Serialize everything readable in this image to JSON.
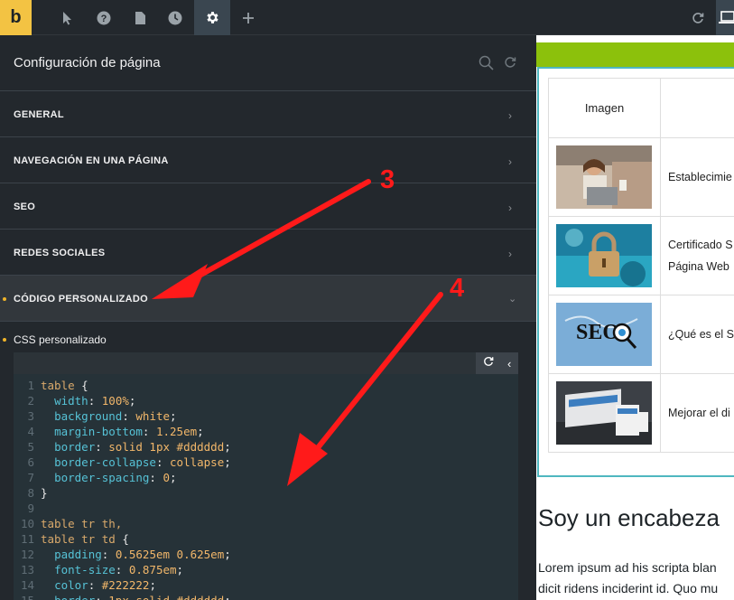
{
  "topbar": {
    "logo": "b",
    "icons": [
      "cursor-icon",
      "help-icon",
      "pages-icon",
      "history-icon",
      "settings-icon",
      "plus-icon"
    ],
    "right_icons": [
      "refresh-icon",
      "desktop-icon"
    ]
  },
  "panel": {
    "title": "Configuración de página",
    "sections": [
      {
        "label": "GENERAL"
      },
      {
        "label": "NAVEGACIÓN EN UNA PÁGINA"
      },
      {
        "label": "SEO"
      },
      {
        "label": "REDES SOCIALES"
      },
      {
        "label": "CÓDIGO PERSONALIZADO"
      }
    ],
    "css_label": "CSS personalizado"
  },
  "editor": {
    "lines": [
      "table {",
      "  width: 100%;",
      "  background: white;",
      "  margin-bottom: 1.25em;",
      "  border: solid 1px #dddddd;",
      "  border-collapse: collapse;",
      "  border-spacing: 0;",
      "}",
      "",
      "table tr th,",
      "table tr td {",
      "  padding: 0.5625em 0.625em;",
      "  font-size: 0.875em;",
      "  color: #222222;",
      "  border: 1px solid #dddddd;"
    ]
  },
  "preview": {
    "table_header": "Imagen",
    "rows": [
      {
        "text": "Establecimie"
      },
      {
        "text": "Certificado S",
        "text2": "Página Web"
      },
      {
        "text": "¿Qué es el S"
      },
      {
        "text": "Mejorar el di"
      }
    ],
    "heading": "Soy un encabeza",
    "para_line1": "Lorem ipsum ad his scripta blan",
    "para_line2": "dicit ridens inciderint id. Quo mu"
  },
  "annotations": {
    "label3": "3",
    "label4": "4",
    "color": "#ff1a1a"
  },
  "colors": {
    "accent": "#f3c343",
    "green_bar": "#8cc10c",
    "table_border": "#4fb7c0"
  }
}
